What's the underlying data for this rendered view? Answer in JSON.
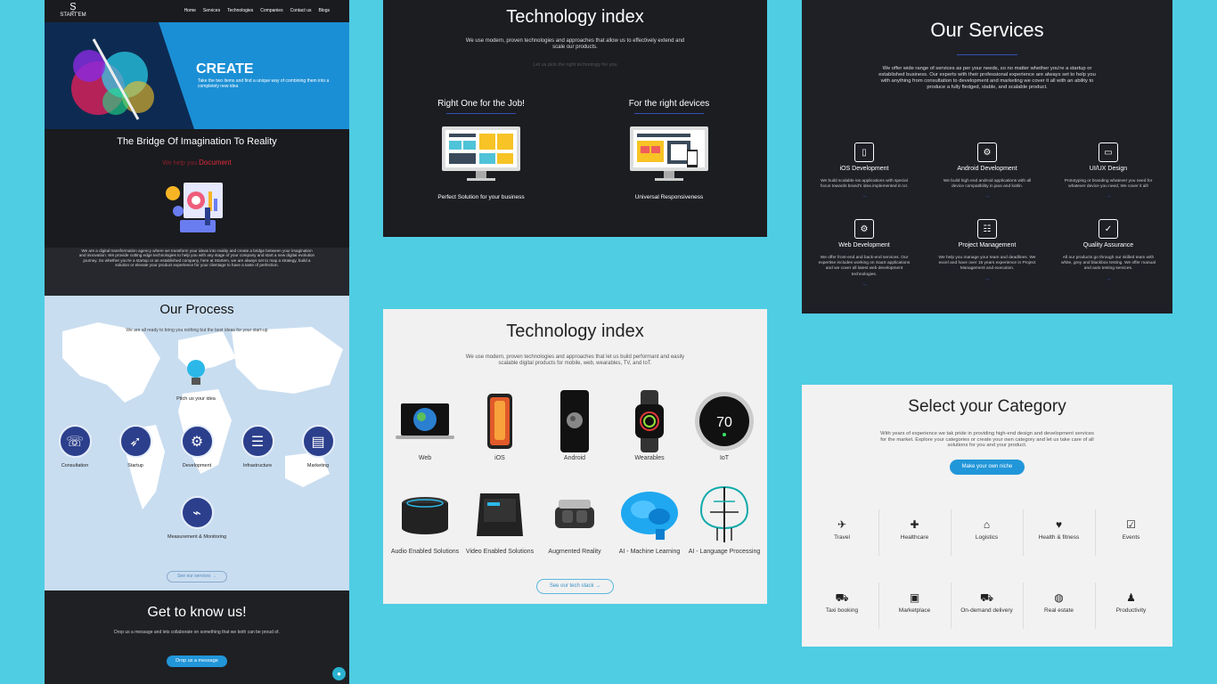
{
  "landing": {
    "logo": "START'EM",
    "nav": [
      "Home",
      "Services",
      "Technologies",
      "Companies",
      "Contact us",
      "Blogs"
    ],
    "hero_title": "CREATE",
    "hero_text": "Take the two items and find a unique way of combining them into a completely new idea",
    "bridge_title": "The Bridge Of Imagination To Reality",
    "help_prefix": "We help you",
    "help_word": "Document",
    "about_text": "We are a digital transformation agency where we transform your ideas into reality and create a bridge between your imagination and innovation. We provide cutting edge technologies to help you with any stage of your company and start a new digital evolution journey. So whether you're a startup or an established company, here at Startem, we are always set to map a strategy, build a solution or elevate your product experience for your clientage to have a taste of perfection.",
    "process_title": "Our Process",
    "process_sub": "We are all ready to bring you nothing but the best ideas for your start-up",
    "pitch": "Pitch us your idea",
    "steps": [
      "Consultation",
      "Startup",
      "Development",
      "Infrastructure",
      "Marketing",
      "Measurement & Monitoring"
    ],
    "see_services": "See our services →",
    "know_title": "Get to know us!",
    "know_text": "Drop us a message and lets collaborate on something that we both can be proud of.",
    "know_btn": "Drop us a message"
  },
  "tech_dark": {
    "title": "Technology index",
    "desc": "We use modern, proven technologies and approaches that allow us to effectively extend and scale our products.",
    "pick": "Let us pick the right technology for you",
    "col1_title": "Right One for the Job!",
    "col1_text": "Perfect Solution for your business",
    "col2_title": "For the right devices",
    "col2_text": "Universal Responsiveness"
  },
  "tech_light": {
    "title": "Technology index",
    "desc": "We use modern, proven technologies and approaches that let us build performant and easily scalable digital products for mobile, web, wearables, TV, and IoT.",
    "devices": [
      "Web",
      "iOS",
      "Android",
      "Wearables",
      "IoT",
      "Audio Enabled Solutions",
      "Video Enabled Solutions",
      "Augmented Reality",
      "AI - Machine Learning",
      "AI - Language Processing"
    ],
    "thermostat_value": "70",
    "button": "See our tech stack →"
  },
  "services": {
    "title": "Our Services",
    "desc": "We offer wide range of services as per your needs, so no matter whether you're a startup or established business. Our experts with their professional experience are always set to help you with anything from consultation to development and marketing we cover it all with an ability to produce a fully fledged, stable, and scalable product.",
    "items": [
      {
        "name": "iOS Development",
        "icon": "phone-icon",
        "text": "We build scalable ios applications with special focus towards brand's idea implemented in UI."
      },
      {
        "name": "Android Development",
        "icon": "android-icon",
        "text": "We build high end android applications with all device compatibility in java and kotlin."
      },
      {
        "name": "UI/UX Design",
        "icon": "design-icon",
        "text": "Prototyping or branding whatever you need for whatever device you need, We cover it all!"
      },
      {
        "name": "Web Development",
        "icon": "web-icon",
        "text": "We offer front-end and back-end services. Our expertise includes working on SaaS applications and we cover all latest web development technologies."
      },
      {
        "name": "Project Management",
        "icon": "clipboard-icon",
        "text": "We help you manage your team and deadlines. We excel and have over 15 years experience in Project Management and execution."
      },
      {
        "name": "Quality Assurance",
        "icon": "checklist-icon",
        "text": "All our products go through our skilled team with white, grey and blackbox testing. We offer manual and auto testing services."
      }
    ]
  },
  "category": {
    "title": "Select your Category",
    "desc": "With years of experience we tak pride in providing high-end design and development services for the market. Explore your categories or create your own category and let us take care of all solutions for you and your product.",
    "button": "Make your own niche",
    "items": [
      {
        "label": "Travel",
        "icon": "plane-icon"
      },
      {
        "label": "Healthcare",
        "icon": "medkit-icon"
      },
      {
        "label": "Logistics",
        "icon": "warehouse-icon"
      },
      {
        "label": "Health & fitness",
        "icon": "heart-icon"
      },
      {
        "label": "Events",
        "icon": "calendar-icon"
      },
      {
        "label": "Taxi booking",
        "icon": "taxi-icon"
      },
      {
        "label": "Marketplace",
        "icon": "money-icon"
      },
      {
        "label": "On-demand delivery",
        "icon": "truck-icon"
      },
      {
        "label": "Real estate",
        "icon": "globe-icon"
      },
      {
        "label": "Productivity",
        "icon": "user-icon"
      }
    ]
  }
}
